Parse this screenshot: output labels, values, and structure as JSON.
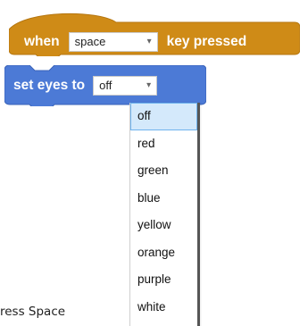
{
  "colors": {
    "event_block": "#cf8b17",
    "looks_block": "#4c7ad6",
    "selected_item_bg": "#d4e9fb",
    "selected_item_border": "#6fb3ee"
  },
  "hat_block": {
    "when_label": "when",
    "key_value": "space",
    "key_pressed_label": "key pressed"
  },
  "set_block": {
    "label": "set eyes to",
    "value": "off"
  },
  "menu": {
    "items": [
      "off",
      "red",
      "green",
      "blue",
      "yellow",
      "orange",
      "purple",
      "white"
    ],
    "selected_index": 0
  },
  "instruction": {
    "text": "ress Space"
  },
  "icons": {
    "dropdown": "chevron-down-icon"
  }
}
